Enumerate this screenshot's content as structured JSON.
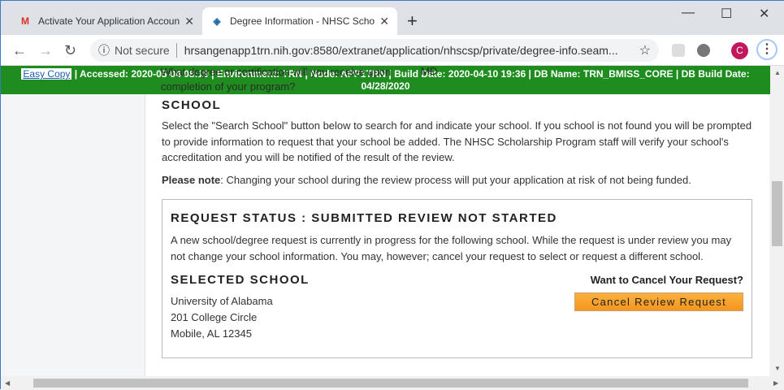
{
  "browser": {
    "tabs": [
      {
        "title": "Activate Your Application Accoun",
        "icon": "gmail-icon"
      },
      {
        "title": "Degree Information - NHSC Scho",
        "icon": "site-icon"
      }
    ],
    "security": "Not secure",
    "url": "hrsangenapp1trn.nih.gov:8580/extranet/application/nhscsp/private/degree-info.seam...",
    "avatar_letter": "C"
  },
  "behind_banner": {
    "question": "What degree or certification will you receive upon completion of your program?",
    "value": "MD"
  },
  "banner": {
    "easy_copy": "Easy Copy",
    "info": " | Accessed: 2020-05-04 08:19 | Environment: TRN | Node: APP1TRN | Build Date: 2020-04-10 19:36 | DB Name: TRN_BMISS_CORE | DB Build Date: 04/28/2020",
    "color": "#1e8c1e"
  },
  "school": {
    "heading": "SCHOOL",
    "instructions": "Select the \"Search School\" button below to search for and indicate your school. If you school is not found you will be prompted to provide information to request that your school be added. The NHSC Scholarship Program staff will verify your school's accreditation and you will be notified of the result of the review.",
    "note_label": "Please note",
    "note_text": ": Changing your school during the review process will put your application at risk of not being funded."
  },
  "request": {
    "status_heading": "REQUEST STATUS : SUBMITTED REVIEW NOT STARTED",
    "message": "A new school/degree request is currently in progress for the following school. While the request is under review you may not change your school information. You may, however; cancel your request to select or request a different school.",
    "selected_heading": "SELECTED SCHOOL",
    "school_name": "University of Alabama",
    "street": "201 College Circle",
    "city": "Mobile, AL 12345",
    "cancel_prompt": "Want to Cancel Your Request?",
    "cancel_button": "Cancel Review Request"
  }
}
